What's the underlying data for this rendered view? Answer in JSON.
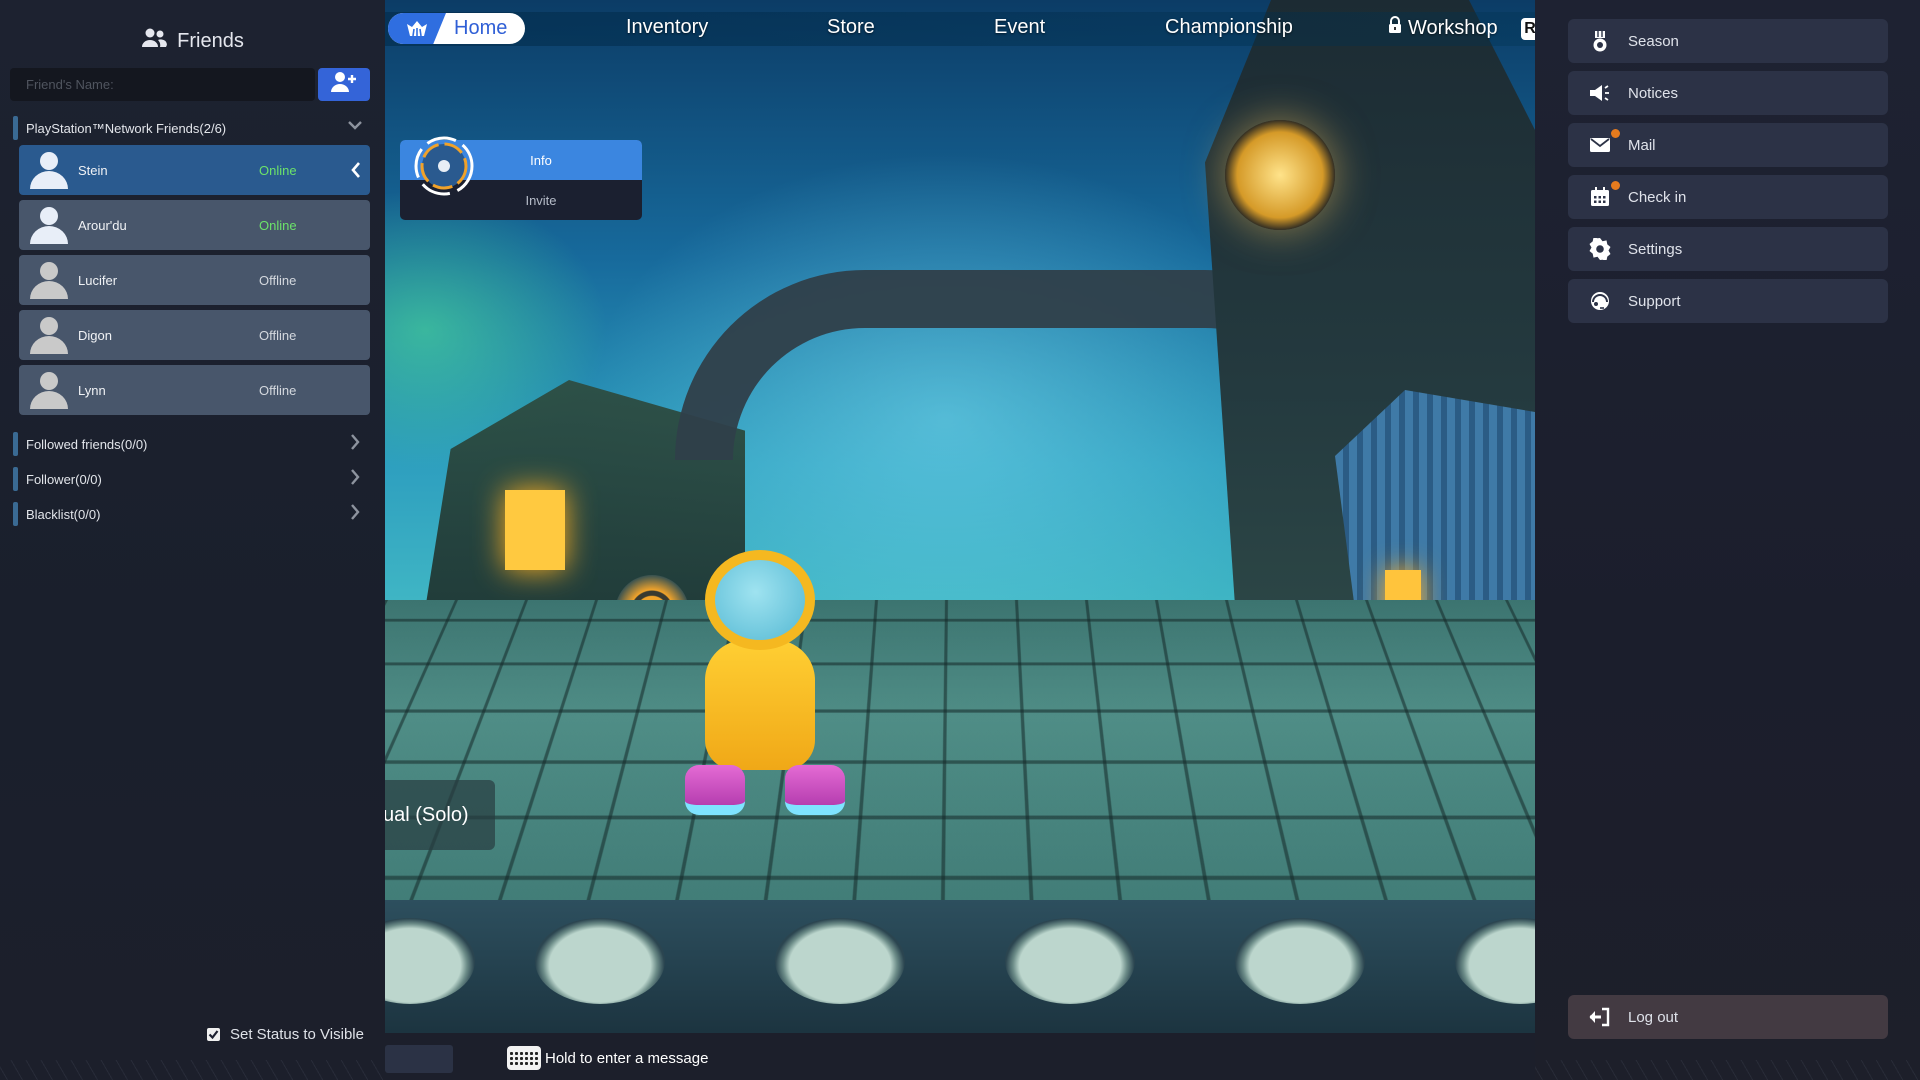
{
  "friends_panel": {
    "title": "Friends",
    "title_icon": "friends-icon",
    "search_placeholder": "Friend's Name:",
    "search_value": "",
    "add_friend_icon": "add-friend-icon",
    "psn_section": {
      "label": "PlayStation™Network Friends(2/6)",
      "expanded": true
    },
    "friends": [
      {
        "name": "Stein",
        "status": "Online",
        "online": true,
        "selected": true
      },
      {
        "name": "Arour'du",
        "status": "Online",
        "online": true,
        "selected": false
      },
      {
        "name": "Lucifer",
        "status": "Offline",
        "online": false,
        "selected": false
      },
      {
        "name": "Digon",
        "status": "Offline",
        "online": false,
        "selected": false
      },
      {
        "name": "Lynn",
        "status": "Offline",
        "online": false,
        "selected": false
      }
    ],
    "other_sections": [
      {
        "label": "Followed friends(0/0)"
      },
      {
        "label": "Follower(0/0)"
      },
      {
        "label": "Blacklist(0/0)"
      }
    ],
    "visibility": {
      "label": "Set Status to Visible",
      "checked": true
    }
  },
  "context_menu": {
    "items": [
      {
        "label": "Info",
        "active": true
      },
      {
        "label": "Invite",
        "active": false
      }
    ]
  },
  "top_nav": {
    "tabs": [
      {
        "label": "Home",
        "active": true,
        "icon": "home-crown-icon"
      },
      {
        "label": "Inventory",
        "active": false
      },
      {
        "label": "Store",
        "active": false
      },
      {
        "label": "Event",
        "active": false
      },
      {
        "label": "Championship",
        "active": false
      },
      {
        "label": "Workshop",
        "active": false,
        "locked": true
      }
    ],
    "extra_button_glyph": "R"
  },
  "game_mode": {
    "label": "Casual (Solo)",
    "visible_text": "sual (Solo)"
  },
  "chat_bar": {
    "hint": "Hold to enter a message",
    "icon": "keyboard-icon"
  },
  "right_menu": {
    "items": [
      {
        "label": "Season",
        "icon": "medal-icon",
        "badge": false
      },
      {
        "label": "Notices",
        "icon": "megaphone-icon",
        "badge": false
      },
      {
        "label": "Mail",
        "icon": "mail-icon",
        "badge": true
      },
      {
        "label": "Check in",
        "icon": "calendar-icon",
        "badge": true
      },
      {
        "label": "Settings",
        "icon": "gear-icon",
        "badge": false
      },
      {
        "label": "Support",
        "icon": "headset-icon",
        "badge": false
      }
    ],
    "logout": {
      "label": "Log out",
      "icon": "logout-icon"
    }
  },
  "colors": {
    "accent_blue": "#3464d8",
    "selected_friend": "#2a5a8f",
    "online_green": "#6ce26a",
    "badge_orange": "#e67b1e",
    "popup_active": "#3b86e0"
  }
}
